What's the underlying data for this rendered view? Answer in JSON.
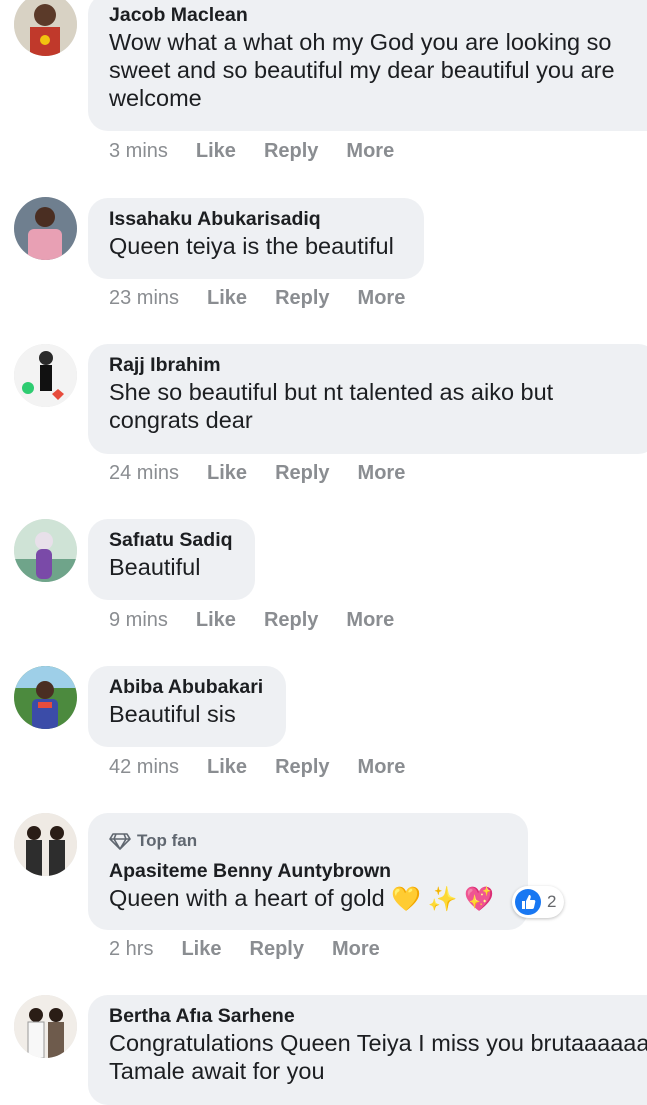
{
  "comments": [
    {
      "author": "Jacob Maclean",
      "text": "Wow what a what oh my God you are looking so sweet and so beautiful my dear beautiful you are welcome",
      "time": "3 mins",
      "like": "Like",
      "reply": "Reply",
      "more": "More",
      "avatar_color": "#c0392b"
    },
    {
      "author": "Issahaku Abukarisadiq",
      "text": "Queen teiya is the beautiful",
      "time": "23 mins",
      "like": "Like",
      "reply": "Reply",
      "more": "More",
      "avatar_color": "#e8a0b4"
    },
    {
      "author": "Rajj Ibrahim",
      "text": "She so beautiful but nt talented as aiko but congrats dear",
      "time": "24 mins",
      "like": "Like",
      "reply": "Reply",
      "more": "More",
      "avatar_color": "#f3f3f3"
    },
    {
      "author": "Safıatu Sadiq",
      "text": "Beautiful",
      "time": "9 mins",
      "like": "Like",
      "reply": "Reply",
      "more": "More",
      "avatar_color": "#9bb7a6"
    },
    {
      "author": "Abiba Abubakari",
      "text": "Beautiful sis",
      "time": "42 mins",
      "like": "Like",
      "reply": "Reply",
      "more": "More",
      "avatar_color": "#3b4ca8"
    },
    {
      "badge": "Top fan",
      "author": "Apasiteme Benny Auntybrown",
      "text": "Queen with a heart of gold",
      "emojis": [
        "💛",
        "✨",
        "💖"
      ],
      "reaction_count": "2",
      "time": "2 hrs",
      "like": "Like",
      "reply": "Reply",
      "more": "More",
      "avatar_color": "#5a4a3f"
    },
    {
      "author": "Bertha Afıa Sarhene",
      "text": "Congratulations Queen Teiya I miss you brutaaaaaa Tamale await for you",
      "time": "",
      "like": "",
      "reply": "",
      "more": "",
      "avatar_color": "#6e5b4c"
    }
  ],
  "icons": {
    "like_reaction": "like-icon",
    "top_fan_badge": "diamond-icon"
  },
  "colors": {
    "bubble": "#eef0f3",
    "action_text": "#8a8d91",
    "like_blue": "#1877f2"
  }
}
